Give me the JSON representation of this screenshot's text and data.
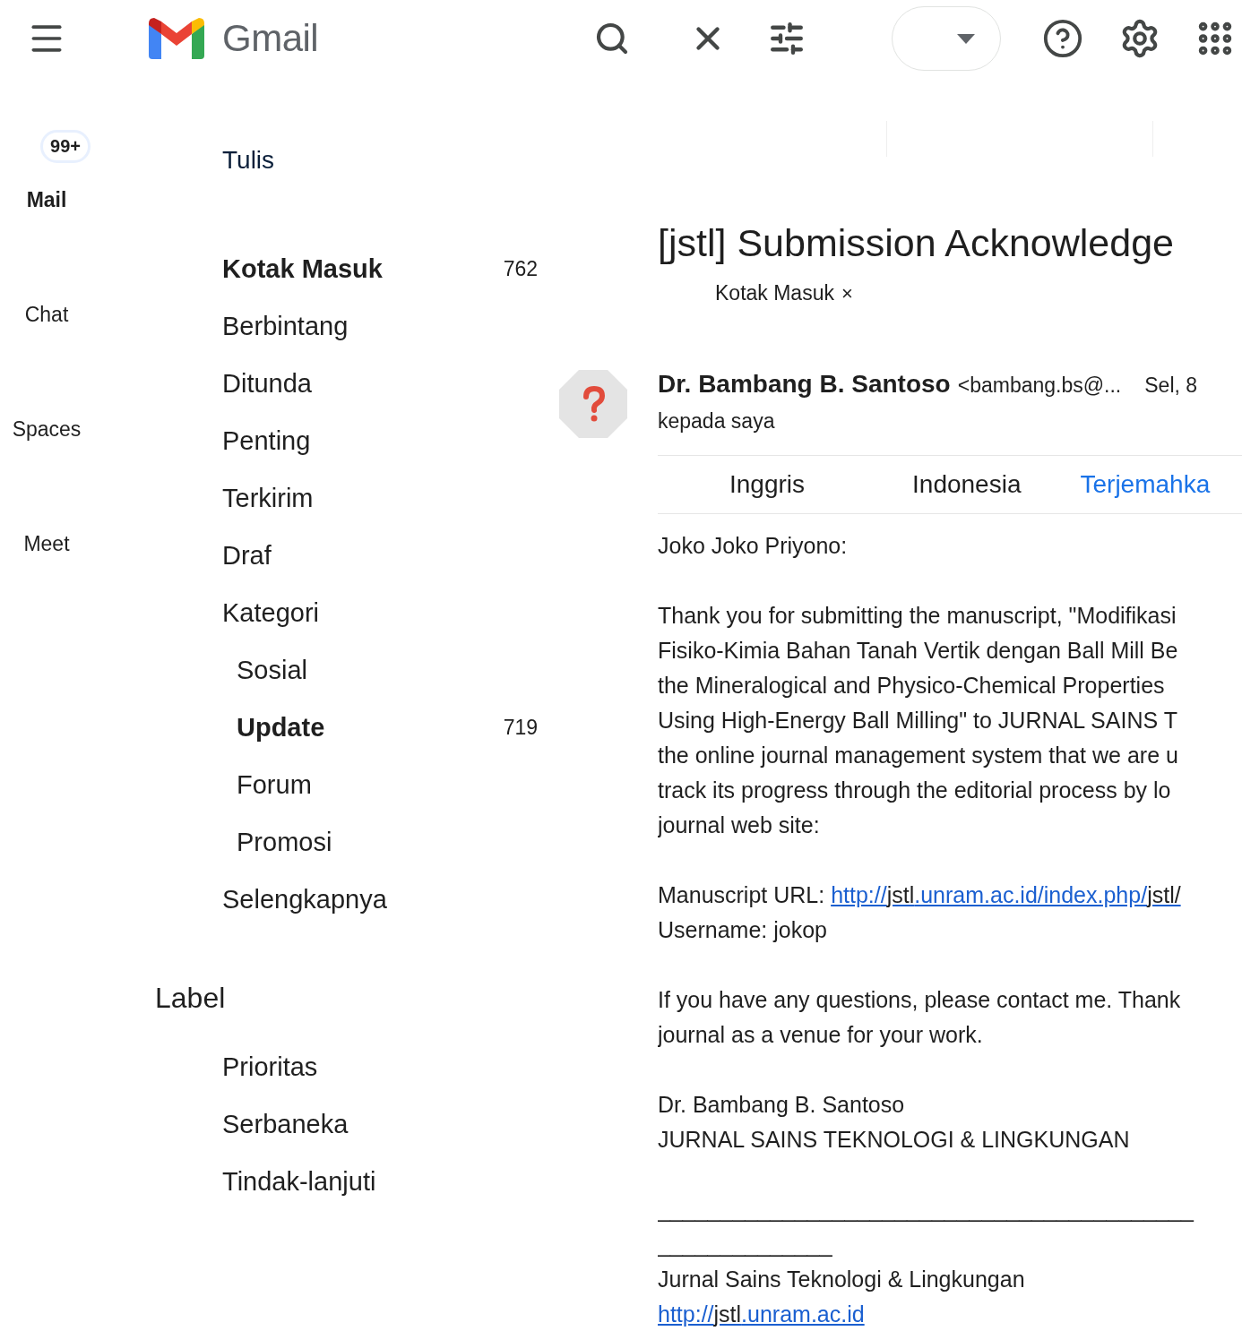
{
  "header": {
    "brand": "Gmail"
  },
  "rail": {
    "badge": "99+",
    "items": [
      {
        "label": "Mail",
        "selected": true
      },
      {
        "label": "Chat",
        "selected": false
      },
      {
        "label": "Spaces",
        "selected": false
      },
      {
        "label": "Meet",
        "selected": false
      }
    ]
  },
  "nav": {
    "compose": "Tulis",
    "items": [
      {
        "label": "Kotak Masuk",
        "count": "762",
        "bold": true
      },
      {
        "label": "Berbintang",
        "bold": false
      },
      {
        "label": "Ditunda",
        "bold": false
      },
      {
        "label": "Penting",
        "bold": false
      },
      {
        "label": "Terkirim",
        "bold": false
      },
      {
        "label": "Draf",
        "bold": false
      },
      {
        "label": "Kategori",
        "bold": false,
        "children": [
          {
            "label": "Sosial",
            "bold": false
          },
          {
            "label": "Update",
            "count": "719",
            "bold": true
          },
          {
            "label": "Forum",
            "bold": false
          },
          {
            "label": "Promosi",
            "bold": false
          }
        ]
      },
      {
        "label": "Selengkapnya",
        "bold": false
      }
    ],
    "labels_heading": "Label",
    "labels": [
      "Prioritas",
      "Serbaneka",
      "Tindak-lanjuti"
    ]
  },
  "message": {
    "subject": "[jstl] Submission Acknowledge",
    "tag": "Kotak Masuk",
    "tag_remove": "×",
    "sender": "Dr. Bambang B. Santoso",
    "sender_email": "<bambang.bs@...",
    "date": "Sel, 8",
    "recipient": "kepada saya",
    "translate": [
      {
        "label": "Inggris",
        "kind": "language"
      },
      {
        "label": "Indonesia",
        "kind": "language"
      },
      {
        "label": "Terjemahka",
        "kind": "action"
      }
    ],
    "body": [
      {
        "kind": "text",
        "lines": [
          "Joko Joko Priyono:"
        ]
      },
      {
        "kind": "text",
        "lines": [
          "Thank you for submitting the manuscript, \"Modifikasi",
          "Fisiko-Kimia Bahan Tanah Vertik dengan Ball Mill Be",
          "the Mineralogical and Physico-Chemical Properties",
          "Using High-Energy Ball Milling\" to JURNAL SAINS T",
          "the online journal management system that we are u",
          "track its progress through the editorial process by lo",
          "journal web site:"
        ]
      },
      {
        "kind": "url",
        "label": "Manuscript URL:",
        "parts": [
          {
            "text": "http://",
            "linked": true
          },
          {
            "text": "jstl",
            "linked": false
          },
          {
            "text": ".unram.ac.id/index.php/",
            "linked": true
          },
          {
            "text": "jstl/",
            "linked": false
          }
        ],
        "after": "Username: jokop"
      },
      {
        "kind": "text",
        "lines": [
          "If you have any questions, please contact me. Thank",
          "journal as a venue for your work."
        ]
      },
      {
        "kind": "text",
        "lines": [
          "Dr. Bambang B. Santoso",
          "JURNAL SAINS TEKNOLOGI & LINGKUNGAN"
        ]
      },
      {
        "kind": "text",
        "lines": [
          "___________________________________________",
          "______________"
        ]
      },
      {
        "kind": "signature",
        "lines": [
          "Jurnal Sains Teknologi & Lingkungan"
        ],
        "parts": [
          {
            "text": "http://",
            "linked": true
          },
          {
            "text": "jstl",
            "linked": false
          },
          {
            "text": ".unram.ac.id",
            "linked": true
          }
        ]
      }
    ]
  }
}
